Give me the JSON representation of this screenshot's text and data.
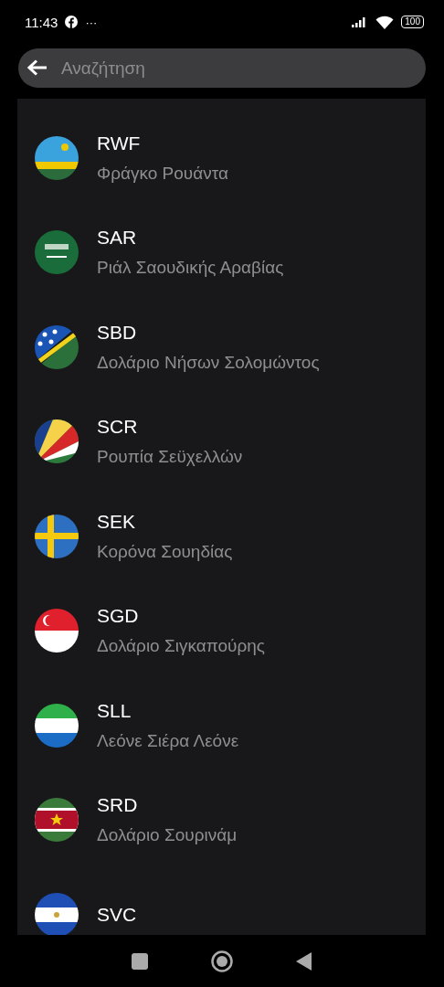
{
  "status_bar": {
    "time": "11:43",
    "more": "···",
    "battery": "100"
  },
  "search": {
    "placeholder": "Αναζήτηση"
  },
  "currencies": [
    {
      "code": "RWF",
      "name": "Φράγκο Ρουάντα"
    },
    {
      "code": "SAR",
      "name": "Ριάλ Σαουδικής Αραβίας"
    },
    {
      "code": "SBD",
      "name": "Δολάριο Νήσων Σολομώντος"
    },
    {
      "code": "SCR",
      "name": "Ρουπία Σεϋχελλών"
    },
    {
      "code": "SEK",
      "name": "Κορόνα Σουηδίας"
    },
    {
      "code": "SGD",
      "name": "Δολάριο Σιγκαπούρης"
    },
    {
      "code": "SLL",
      "name": "Λεόνε Σιέρα Λεόνε"
    },
    {
      "code": "SRD",
      "name": "Δολάριο Σουρινάμ"
    },
    {
      "code": "SVC"
    }
  ]
}
